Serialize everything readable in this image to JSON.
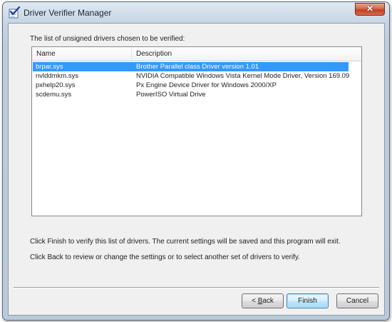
{
  "window": {
    "title": "Driver Verifier Manager",
    "close_glyph": "✕"
  },
  "list": {
    "caption": "The list of unsigned drivers chosen to be verified:",
    "columns": [
      "Name",
      "Description"
    ],
    "rows": [
      {
        "name": "brpar.sys",
        "description": "Brother Parallel class Driver  version 1.01",
        "selected": true
      },
      {
        "name": "nvlddmkm.sys",
        "description": "NVIDIA Compatible Windows Vista Kernel Mode Driver, Version 169.09",
        "selected": false
      },
      {
        "name": "pxhelp20.sys",
        "description": "Px Engine Device Driver for Windows 2000/XP",
        "selected": false
      },
      {
        "name": "scdemu.sys",
        "description": "PowerISO Virtual Drive",
        "selected": false
      }
    ]
  },
  "info": {
    "line1": "Click Finish to verify this list of drivers. The current settings will be saved and this program will exit.",
    "line2": "Click Back to review or change the settings or to select another set of drivers to verify."
  },
  "buttons": {
    "back_prefix": "< ",
    "back_accel": "B",
    "back_rest": "ack",
    "finish": "Finish",
    "cancel": "Cancel"
  },
  "colors": {
    "selection": "#3399ff",
    "window_frame": "#b9cadb",
    "close_button": "#c2401f"
  },
  "icons": {
    "app": "checklist-icon",
    "close": "close-icon"
  }
}
